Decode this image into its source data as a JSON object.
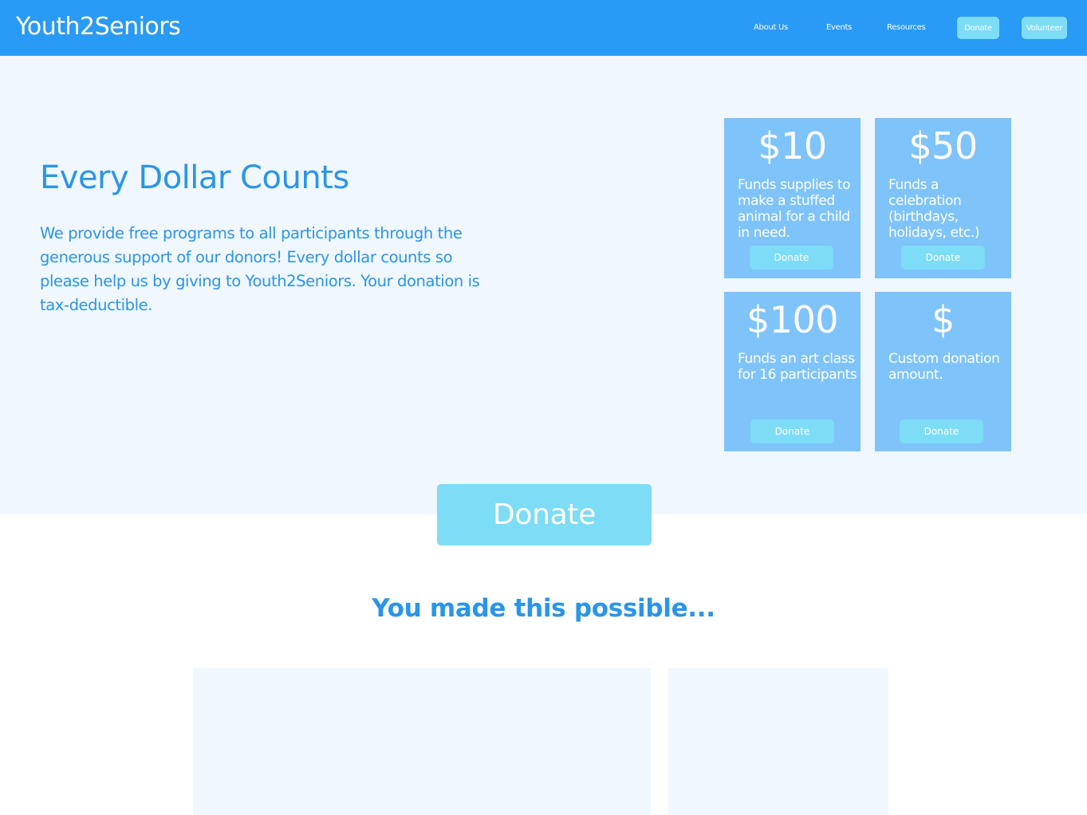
{
  "navbar": {
    "brand": "Youth2Seniors",
    "links": [
      "About Us",
      "Events",
      "Resources"
    ],
    "donate_label": "Donate",
    "volunteer_label": "Volunteer"
  },
  "hero": {
    "title": "Every Dollar Counts",
    "text": "We provide free programs to all participants through the generous support of our donors!  Every dollar counts so please help us by giving to Youth2Seniors.  Your donation is tax-deductible."
  },
  "cards": [
    {
      "amount": "$10",
      "description": "Funds supplies to make a stuffed animal for a child in need.",
      "button": "Donate"
    },
    {
      "amount": "$50",
      "description": "Funds a celebration (birthdays, holidays, etc.)",
      "button": "Donate"
    },
    {
      "amount": "$100",
      "description": "Funds an art class for 16 participants",
      "button": "Donate"
    },
    {
      "amount": "$",
      "description": "Custom donation amount.",
      "button": "Donate"
    }
  ],
  "main_donate_label": "Donate",
  "gallery": {
    "heading": "You made this possible..."
  },
  "colors": {
    "navbar": "#2a9af7",
    "accent_button": "#7ddcf6",
    "card": "#7fc3fb",
    "hero_bg": "#f0f7fe",
    "text_blue": "#2a95e8"
  }
}
